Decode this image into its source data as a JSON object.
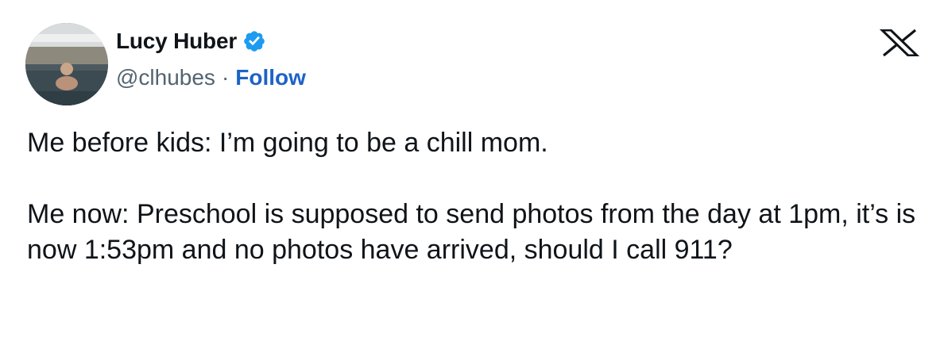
{
  "author": {
    "display_name": "Lucy Huber",
    "handle": "@clhubes",
    "separator": "·",
    "follow_label": "Follow",
    "verified": true,
    "verified_color": "#1d9bf0"
  },
  "brand": {
    "logo_icon": "x-logo-icon"
  },
  "tweet": {
    "paragraphs": [
      "Me before kids: I’m going to be a chill mom.",
      "Me now: Preschool is supposed to send photos from the day at 1pm, it’s is now 1:53pm and no photos have arrived, should I call 911?"
    ]
  },
  "colors": {
    "text": "#0f1419",
    "secondary": "#536471",
    "link": "#1d63c7"
  }
}
